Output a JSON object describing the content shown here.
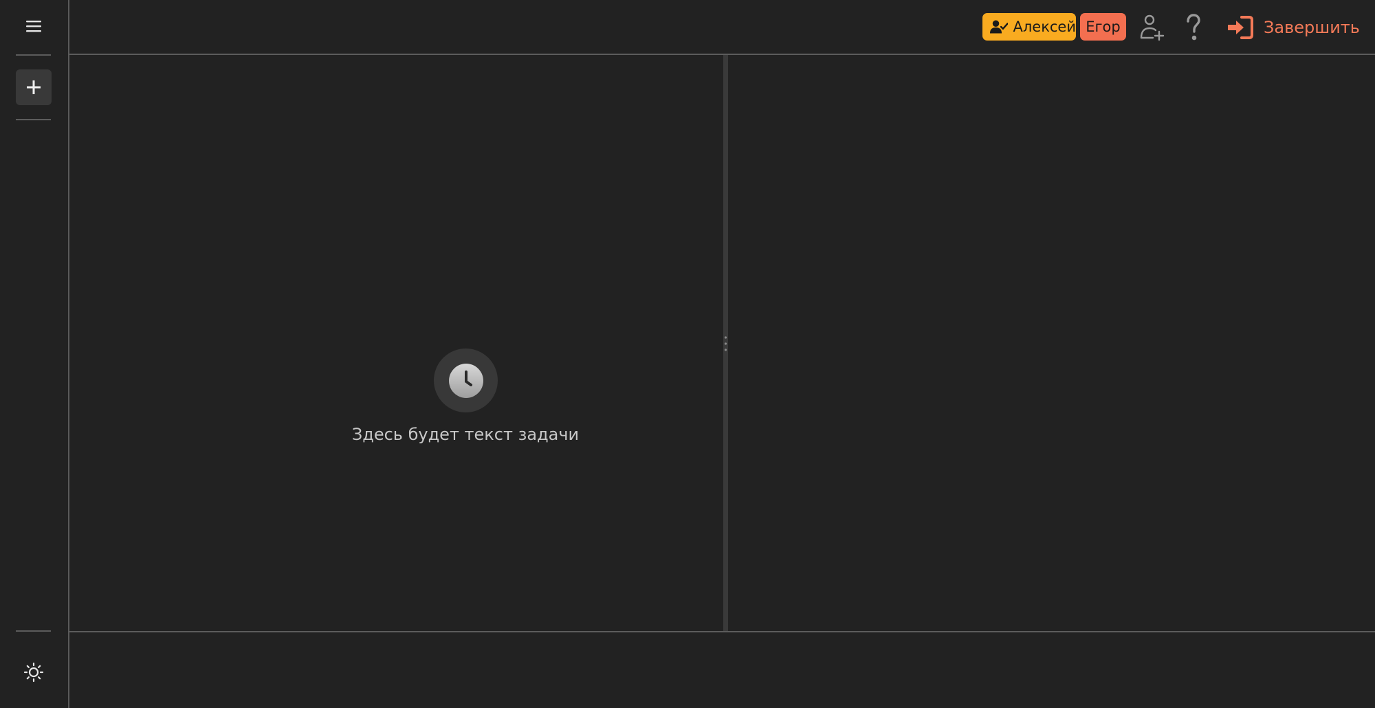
{
  "sidebar": {
    "menu_icon": "hamburger-menu-icon",
    "add_icon": "plus-icon",
    "theme_icon": "sun-icon"
  },
  "header": {
    "participants": [
      {
        "name": "Алексей",
        "icon": "user-check-icon",
        "color": "#f9ab20"
      },
      {
        "name": "Егор",
        "color": "#f36f50"
      }
    ],
    "add_user_icon": "user-plus-icon",
    "help_icon": "question-icon",
    "finish_label": "Завершить",
    "finish_icon": "sign-in-icon",
    "finish_color": "#f47a58"
  },
  "task": {
    "empty_icon": "clock-icon",
    "placeholder": "Здесь будет текст задачи"
  },
  "colors": {
    "background": "#222222",
    "divider": "#5c5c5c"
  }
}
